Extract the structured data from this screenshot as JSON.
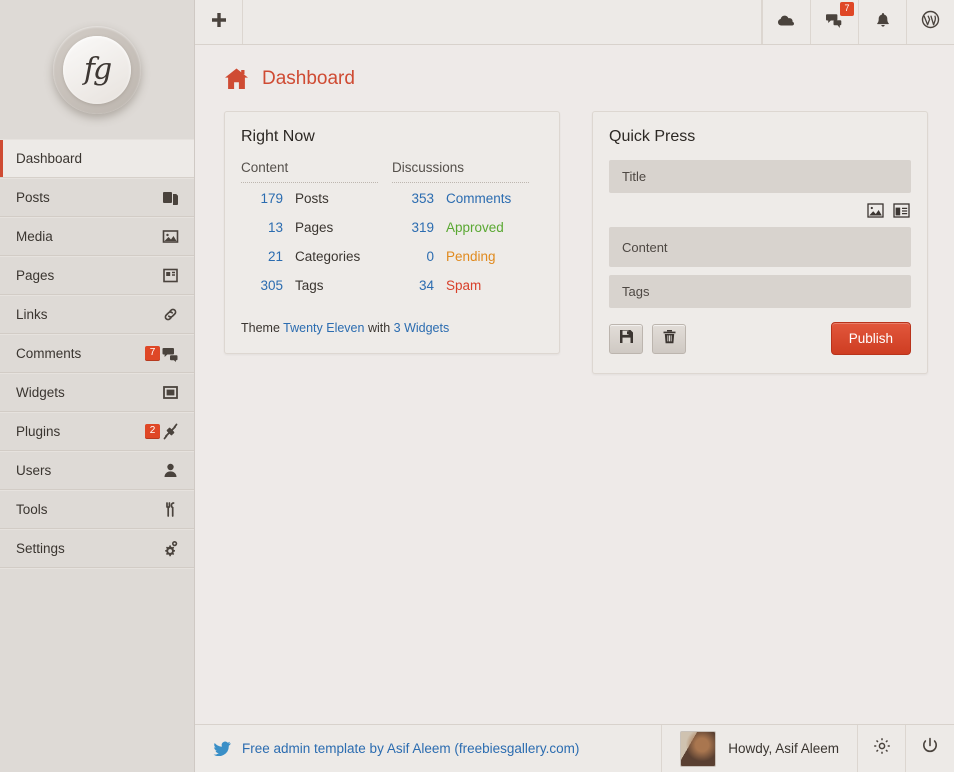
{
  "sidebar": {
    "logo": {
      "glyph": "fg",
      "name": "site-logo"
    },
    "items": [
      {
        "label": "Dashboard",
        "icon": "",
        "badge": "",
        "active": true
      },
      {
        "label": "Posts",
        "icon": "posts-icon",
        "badge": "",
        "active": false
      },
      {
        "label": "Media",
        "icon": "media-icon",
        "badge": "",
        "active": false
      },
      {
        "label": "Pages",
        "icon": "pages-icon",
        "badge": "",
        "active": false
      },
      {
        "label": "Links",
        "icon": "links-icon",
        "badge": "",
        "active": false
      },
      {
        "label": "Comments",
        "icon": "comments-icon",
        "badge": "7",
        "active": false
      },
      {
        "label": "Widgets",
        "icon": "widgets-icon",
        "badge": "",
        "active": false
      },
      {
        "label": "Plugins",
        "icon": "plugins-icon",
        "badge": "2",
        "active": false
      },
      {
        "label": "Users",
        "icon": "users-icon",
        "badge": "",
        "active": false
      },
      {
        "label": "Tools",
        "icon": "tools-icon",
        "badge": "",
        "active": false
      },
      {
        "label": "Settings",
        "icon": "settings-icon",
        "badge": "",
        "active": false
      }
    ]
  },
  "topbar": {
    "add_new_icon": "plus-icon",
    "cloud_icon": "cloud-icon",
    "comments_icon": "comments-bubbles-icon",
    "comments_badge": "7",
    "notifications_icon": "bell-icon",
    "wordpress_icon": "wordpress-logo-icon"
  },
  "page": {
    "title": "Dashboard",
    "title_icon": "home-icon"
  },
  "right_now": {
    "title": "Right Now",
    "content_heading": "Content",
    "discussions_heading": "Discussions",
    "content_rows": [
      {
        "count": "179",
        "label": "Posts"
      },
      {
        "count": "13",
        "label": "Pages"
      },
      {
        "count": "21",
        "label": "Categories"
      },
      {
        "count": "305",
        "label": "Tags"
      }
    ],
    "discussion_rows": [
      {
        "count": "353",
        "label": "Comments",
        "color": "link"
      },
      {
        "count": "319",
        "label": "Approved",
        "color": "green"
      },
      {
        "count": "0",
        "label": "Pending",
        "color": "orange"
      },
      {
        "count": "34",
        "label": "Spam",
        "color": "red"
      }
    ],
    "theme_prefix": "Theme",
    "theme_name": "Twenty Eleven",
    "theme_middle": "with",
    "theme_widgets": "3 Widgets"
  },
  "quick_press": {
    "title": "Quick Press",
    "title_placeholder": "Title",
    "content_placeholder": "Content",
    "tags_placeholder": "Tags",
    "media_image_icon": "insert-image-icon",
    "media_layout_icon": "insert-layout-icon",
    "save_icon": "save-draft-icon",
    "trash_icon": "trash-icon",
    "publish_label": "Publish"
  },
  "footer": {
    "twitter_icon": "twitter-bird-icon",
    "credit": "Free admin template by Asif Aleem (freebiesgallery.com)",
    "greeting": "Howdy, Asif Aleem",
    "settings_icon": "gear-icon",
    "logout_icon": "power-icon"
  },
  "colors": {
    "accent_red": "#CF4B33",
    "link_blue": "#2B6CB0",
    "green": "#5AA832",
    "orange": "#E08A1E",
    "red": "#D8402B",
    "sidebar_bg": "#DEDAD6",
    "content_bg": "#EEEAE8"
  }
}
